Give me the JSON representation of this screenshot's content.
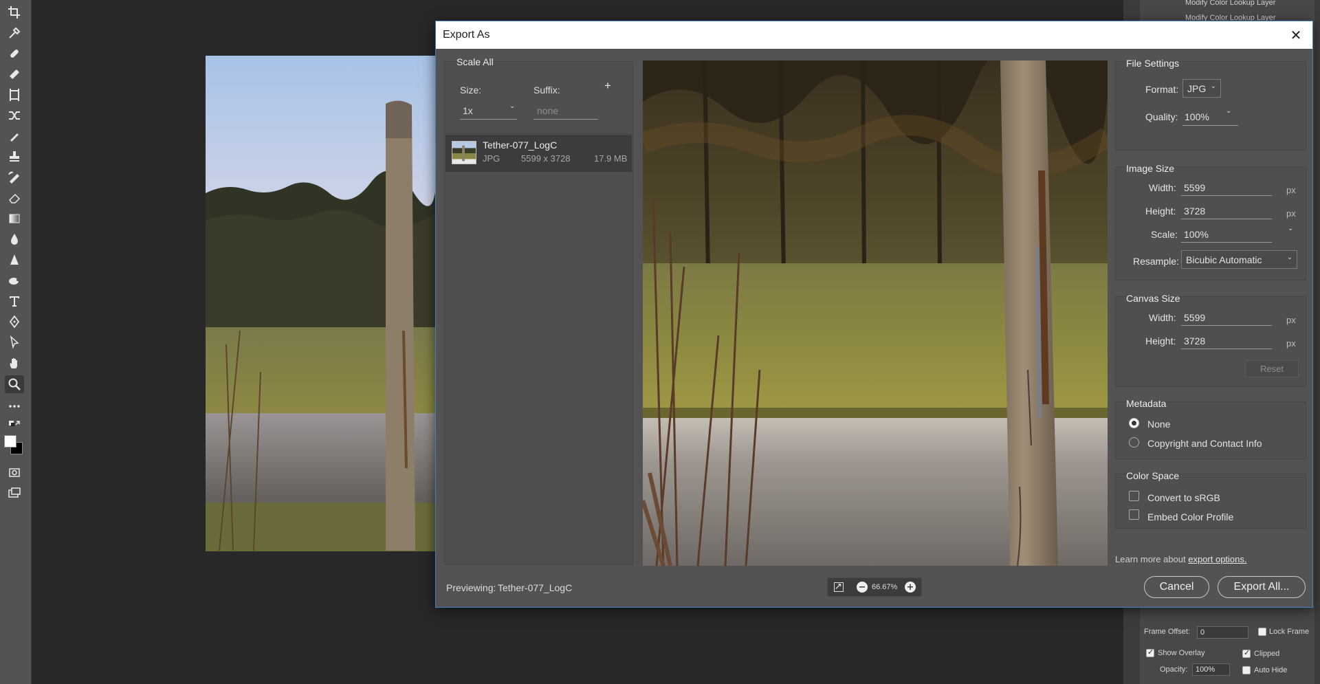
{
  "dialog": {
    "title": "Export As",
    "close_glyph": "✕"
  },
  "scale_panel": {
    "title": "Scale All",
    "size_label": "Size:",
    "size_value": "1x",
    "suffix_label": "Suffix:",
    "suffix_placeholder": "none",
    "add_glyph": "+"
  },
  "file_item": {
    "name": "Tether-077_LogC",
    "format": "JPG",
    "dimensions": "5599 x 3728",
    "size": "17.9 MB"
  },
  "file_settings": {
    "title": "File Settings",
    "format_label": "Format:",
    "format_value": "JPG",
    "quality_label": "Quality:",
    "quality_value": "100%"
  },
  "image_size": {
    "title": "Image Size",
    "width_label": "Width:",
    "width_value": "5599",
    "height_label": "Height:",
    "height_value": "3728",
    "scale_label": "Scale:",
    "scale_value": "100%",
    "resample_label": "Resample:",
    "resample_value": "Bicubic Automatic",
    "unit": "px"
  },
  "canvas_size": {
    "title": "Canvas Size",
    "width_label": "Width:",
    "width_value": "5599",
    "height_label": "Height:",
    "height_value": "3728",
    "unit": "px",
    "reset_label": "Reset"
  },
  "metadata": {
    "title": "Metadata",
    "option_none": "None",
    "option_copyright": "Copyright and Contact Info",
    "selected": "None"
  },
  "color_space": {
    "title": "Color Space",
    "convert_label": "Convert to sRGB",
    "convert_checked": false,
    "embed_label": "Embed Color Profile",
    "embed_checked": false
  },
  "footer": {
    "learn_more_prefix": "Learn more about ",
    "learn_more_link": "export options.",
    "previewing_label": "Previewing:",
    "previewing_name": "Tether-077_LogC",
    "zoom_value": "66.67%",
    "cancel_label": "Cancel",
    "export_label": "Export All..."
  },
  "right_panel": {
    "layer_1": "Modify Color Lookup Layer",
    "layer_2": "Modify Color Lookup Layer",
    "frame_offset_label": "Frame Offset:",
    "frame_offset_value": "0",
    "lock_frame_label": "Lock Frame",
    "show_overlay_label": "Show Overlay",
    "clipped_label": "Clipped",
    "opacity_label": "Opacity:",
    "opacity_value": "100%",
    "auto_hide_label": "Auto Hide"
  },
  "colors": {
    "dialog_bg": "#535353",
    "panel_bg": "#4f4f4f",
    "dialog_border": "#3e86c8",
    "canvas_bg": "#282828"
  }
}
